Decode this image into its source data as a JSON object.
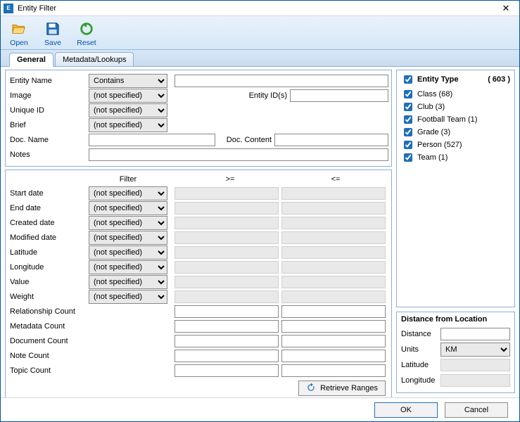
{
  "window": {
    "title": "Entity Filter"
  },
  "toolbar": {
    "open_label": "Open",
    "save_label": "Save",
    "reset_label": "Reset"
  },
  "tabs": {
    "general": "General",
    "metadata": "Metadata/Lookups"
  },
  "fields": {
    "entity_name": {
      "label": "Entity Name",
      "op": "Contains",
      "value": ""
    },
    "image": {
      "label": "Image",
      "op": "(not specified)"
    },
    "entity_ids": {
      "label": "Entity ID(s)",
      "value": ""
    },
    "unique_id": {
      "label": "Unique ID",
      "op": "(not specified)"
    },
    "brief": {
      "label": "Brief",
      "op": "(not specified)"
    },
    "doc_name": {
      "label": "Doc. Name",
      "value": ""
    },
    "doc_content": {
      "label": "Doc. Content",
      "value": ""
    },
    "notes": {
      "label": "Notes",
      "value": ""
    }
  },
  "grid": {
    "headers": {
      "filter": "Filter",
      "gte": ">=",
      "lte": "<="
    },
    "rows": [
      {
        "label": "Start date",
        "op": "(not specified)",
        "has_select": true,
        "editable": false
      },
      {
        "label": "End date",
        "op": "(not specified)",
        "has_select": true,
        "editable": false
      },
      {
        "label": "Created date",
        "op": "(not specified)",
        "has_select": true,
        "editable": false
      },
      {
        "label": "Modified date",
        "op": "(not specified)",
        "has_select": true,
        "editable": false
      },
      {
        "label": "Latitude",
        "op": "(not specified)",
        "has_select": true,
        "editable": false
      },
      {
        "label": "Longitude",
        "op": "(not specified)",
        "has_select": true,
        "editable": false
      },
      {
        "label": "Value",
        "op": "(not specified)",
        "has_select": true,
        "editable": false
      },
      {
        "label": "Weight",
        "op": "(not specified)",
        "has_select": true,
        "editable": false
      },
      {
        "label": "Relationship Count",
        "has_select": false,
        "editable": true
      },
      {
        "label": "Metadata Count",
        "has_select": false,
        "editable": true
      },
      {
        "label": "Document Count",
        "has_select": false,
        "editable": true
      },
      {
        "label": "Note Count",
        "has_select": false,
        "editable": true
      },
      {
        "label": "Topic Count",
        "has_select": false,
        "editable": true
      }
    ],
    "retrieve_label": "Retrieve Ranges"
  },
  "entity_type": {
    "title": "Entity Type",
    "count": "( 603 )",
    "items": [
      {
        "label": "Class (68)"
      },
      {
        "label": "Club (3)"
      },
      {
        "label": "Football Team (1)"
      },
      {
        "label": "Grade (3)"
      },
      {
        "label": "Person (527)"
      },
      {
        "label": "Team (1)"
      }
    ]
  },
  "distance": {
    "title": "Distance from Location",
    "distance_label": "Distance",
    "distance_value": "",
    "units_label": "Units",
    "units_value": "KM",
    "latitude_label": "Latitude",
    "longitude_label": "Longitude"
  },
  "footer": {
    "ok": "OK",
    "cancel": "Cancel"
  }
}
